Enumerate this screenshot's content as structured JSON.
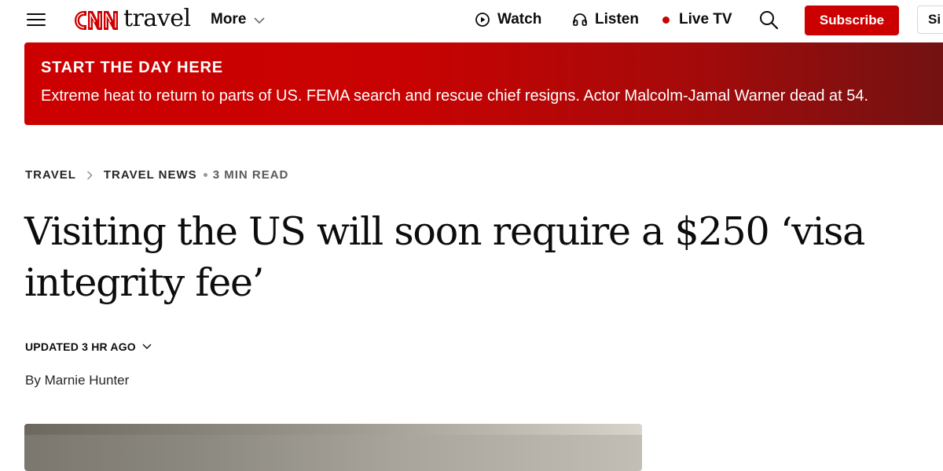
{
  "header": {
    "logo_brand": "CNN",
    "logo_section": "travel",
    "more_label": "More",
    "watch_label": "Watch",
    "listen_label": "Listen",
    "livetv_label": "Live TV",
    "subscribe_label": "Subscribe",
    "signin_label": "Sign in",
    "signin_visible": "Si"
  },
  "banner": {
    "title": "START THE DAY HERE",
    "text": "Extreme heat to return to parts of US. FEMA search and rescue chief resigns. Actor Malcolm-Jamal Warner dead at 54."
  },
  "breadcrumb": {
    "section": "TRAVEL",
    "subsection": "TRAVEL NEWS",
    "read_time": "3 MIN READ"
  },
  "article": {
    "headline": "Visiting the US will soon require a $250 ‘visa integrity fee’",
    "updated": "UPDATED 3 HR AGO",
    "byline_prefix": "By",
    "author": "Marnie Hunter"
  },
  "colors": {
    "brand_red": "#cc0000",
    "text": "#0c0c0c",
    "muted": "#595959"
  },
  "icons": [
    "menu-icon",
    "cnn-logo",
    "chevron-down-icon",
    "play-icon",
    "headphones-icon",
    "live-dot-icon",
    "search-icon",
    "chevron-right-icon"
  ]
}
